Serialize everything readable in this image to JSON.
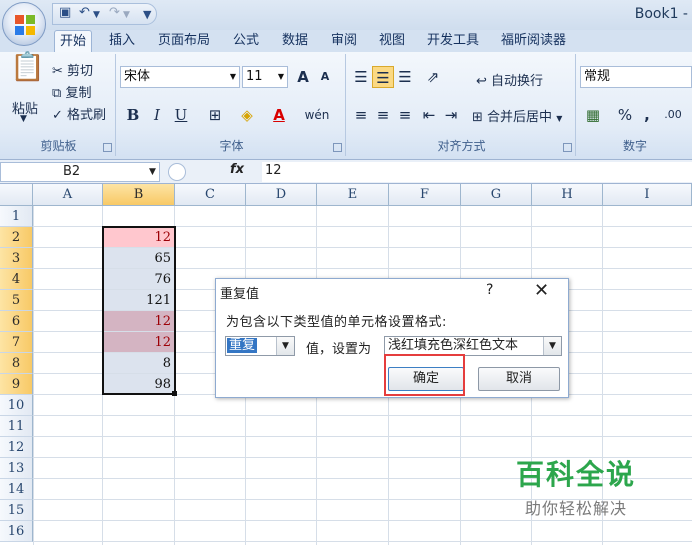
{
  "window": {
    "title": "Book1 -"
  },
  "qat": {
    "save_icon": "save-icon",
    "undo_icon": "undo-icon",
    "redo_icon": "redo-icon"
  },
  "tabs": [
    "开始",
    "插入",
    "页面布局",
    "公式",
    "数据",
    "审阅",
    "视图",
    "开发工具",
    "福昕阅读器"
  ],
  "active_tab": "开始",
  "ribbon": {
    "clipboard": {
      "paste": "粘贴",
      "cut": "剪切",
      "copy": "复制",
      "format_painter": "格式刷",
      "label": "剪贴板"
    },
    "font": {
      "name": "宋体",
      "size": "11",
      "grow": "A",
      "shrink": "A",
      "bold": "B",
      "italic": "I",
      "underline": "U",
      "label": "字体",
      "phonetic": "wén"
    },
    "alignment": {
      "wrap": "自动换行",
      "merge": "合并后居中",
      "label": "对齐方式"
    },
    "number": {
      "format": "常规",
      "percent": "%",
      "comma": ",",
      "label": "数字"
    }
  },
  "formula_bar": {
    "name_box": "B2",
    "fx": "fx",
    "value": "12"
  },
  "columns": [
    "A",
    "B",
    "C",
    "D",
    "E",
    "F",
    "G",
    "H",
    "I"
  ],
  "rows": [
    "1",
    "2",
    "3",
    "4",
    "5",
    "6",
    "7",
    "8",
    "9",
    "10",
    "11",
    "12",
    "13",
    "14",
    "15",
    "16"
  ],
  "selected_column": "B",
  "colors": {
    "dup_fill": "#ffc7ce",
    "dup_text": "#9c0006",
    "sel_tint": "#dce3ee"
  },
  "cells": {
    "B2": "12",
    "B3": "65",
    "B4": "76",
    "B5": "121",
    "B6": "12",
    "B7": "12",
    "B8": "8",
    "B9": "98"
  },
  "dialog": {
    "title": "重复值",
    "help": "?",
    "close": "✕",
    "description": "为包含以下类型值的单元格设置格式:",
    "type_value": "重复",
    "value_label": "值，设置为",
    "format_value": "浅红填充色深红色文本",
    "ok": "确定",
    "cancel": "取消"
  },
  "watermark": {
    "line1": "百科全说",
    "line2": "助你轻松解决"
  }
}
